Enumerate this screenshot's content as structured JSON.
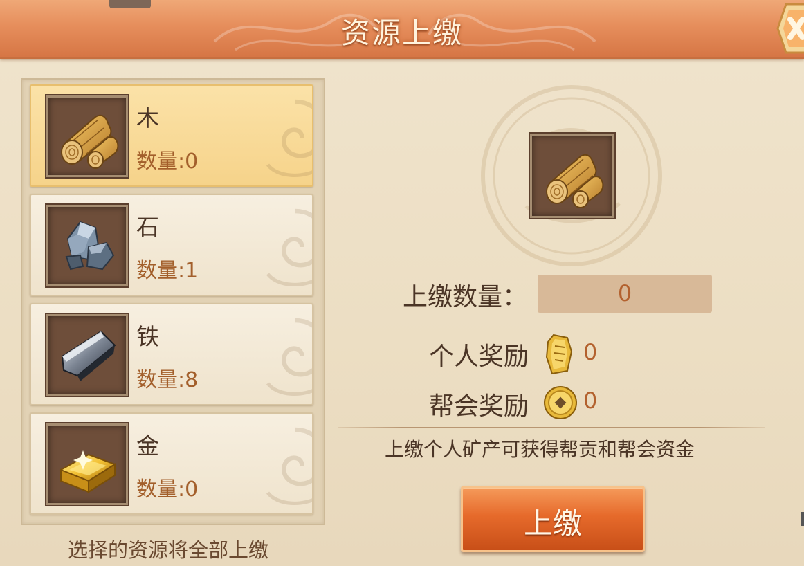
{
  "header": {
    "title": "资源上缴"
  },
  "resources": [
    {
      "name": "木",
      "count_label": "数量:0",
      "icon": "wood-log-icon",
      "selected": true
    },
    {
      "name": "石",
      "count_label": "数量:1",
      "icon": "stone-icon",
      "selected": false
    },
    {
      "name": "铁",
      "count_label": "数量:8",
      "icon": "iron-ingot-icon",
      "selected": false
    },
    {
      "name": "金",
      "count_label": "数量:0",
      "icon": "gold-bar-icon",
      "selected": false
    }
  ],
  "left_hint": "选择的资源将全部上缴",
  "detail": {
    "preview_icon": "wood-log-icon",
    "quantity_label": "上缴数量：",
    "quantity_value": "0",
    "personal_reward_label": "个人奖励",
    "personal_reward_value": "0",
    "personal_reward_icon": "contribution-token-icon",
    "guild_reward_label": "帮会奖励",
    "guild_reward_value": "0",
    "guild_reward_icon": "coin-icon",
    "hint": "上缴个人矿产可获得帮贡和帮会资金",
    "submit_label": "上缴"
  },
  "colors": {
    "header": "#e68e5c",
    "selected_item": "#f6d38a",
    "value_text": "#b3612e",
    "button": "#e66a2b"
  }
}
